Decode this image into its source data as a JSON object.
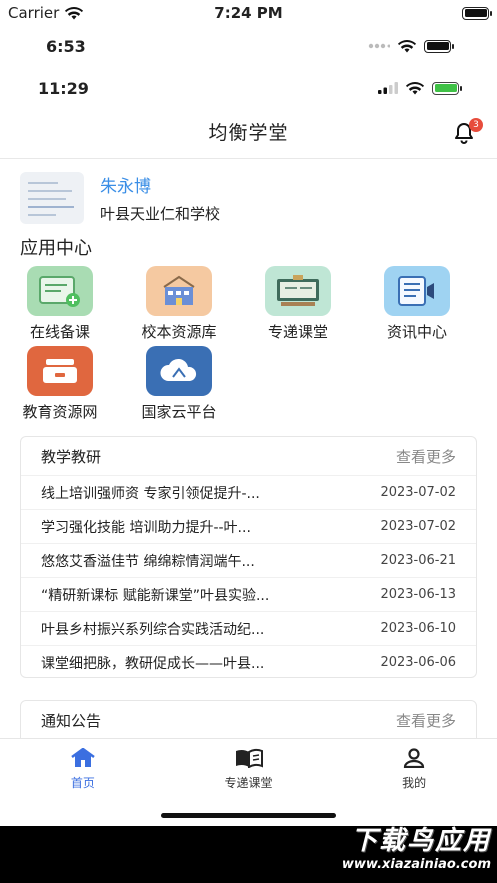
{
  "status_bars": {
    "top": {
      "carrier": "Carrier",
      "time": "7:24 PM"
    },
    "second": {
      "time": "6:53"
    },
    "third": {
      "time": "11:29"
    }
  },
  "header": {
    "title": "均衡学堂",
    "badge_count": "3"
  },
  "profile": {
    "name": "朱永博",
    "school": "叶县天业仁和学校"
  },
  "app_center": {
    "title": "应用中心",
    "apps": [
      {
        "label": "在线备课",
        "icon": "online-lesson-prep-icon",
        "color": "#a9dcb3"
      },
      {
        "label": "校本资源库",
        "icon": "school-resource-library-icon",
        "color": "#f5c9a1"
      },
      {
        "label": "专递课堂",
        "icon": "classroom-broadcast-icon",
        "color": "#bfe6d5"
      },
      {
        "label": "资讯中心",
        "icon": "news-center-icon",
        "color": "#9fd3f2"
      },
      {
        "label": "教育资源网",
        "icon": "education-resource-net-icon",
        "color": "#e0673f"
      },
      {
        "label": "国家云平台",
        "icon": "national-cloud-platform-icon",
        "color": "#3a6fb4"
      }
    ]
  },
  "teaching_research": {
    "title": "教学教研",
    "more": "查看更多",
    "items": [
      {
        "title": "线上培训强师资 专家引领促提升-...",
        "date": "2023-07-02"
      },
      {
        "title": "学习强化技能 培训助力提升--叶...",
        "date": "2023-07-02"
      },
      {
        "title": "悠悠艾香溢佳节 绵绵粽情润端午...",
        "date": "2023-06-21"
      },
      {
        "title": "“精研新课标 赋能新课堂”叶县实验...",
        "date": "2023-06-13"
      },
      {
        "title": "叶县乡村振兴系列综合实践活动纪...",
        "date": "2023-06-10"
      },
      {
        "title": "课堂细把脉，教研促成长——叶县...",
        "date": "2023-06-06"
      }
    ]
  },
  "notice": {
    "title": "通知公告",
    "more": "查看更多"
  },
  "tabbar": {
    "items": [
      {
        "label": "首页",
        "icon": "home-icon"
      },
      {
        "label": "专递课堂",
        "icon": "book-icon"
      },
      {
        "label": "我的",
        "icon": "user-icon"
      }
    ],
    "active_color": "#3b6fe0"
  },
  "watermark": {
    "line1": "下载鸟应用",
    "line2": "www.xiazainiao.com"
  }
}
